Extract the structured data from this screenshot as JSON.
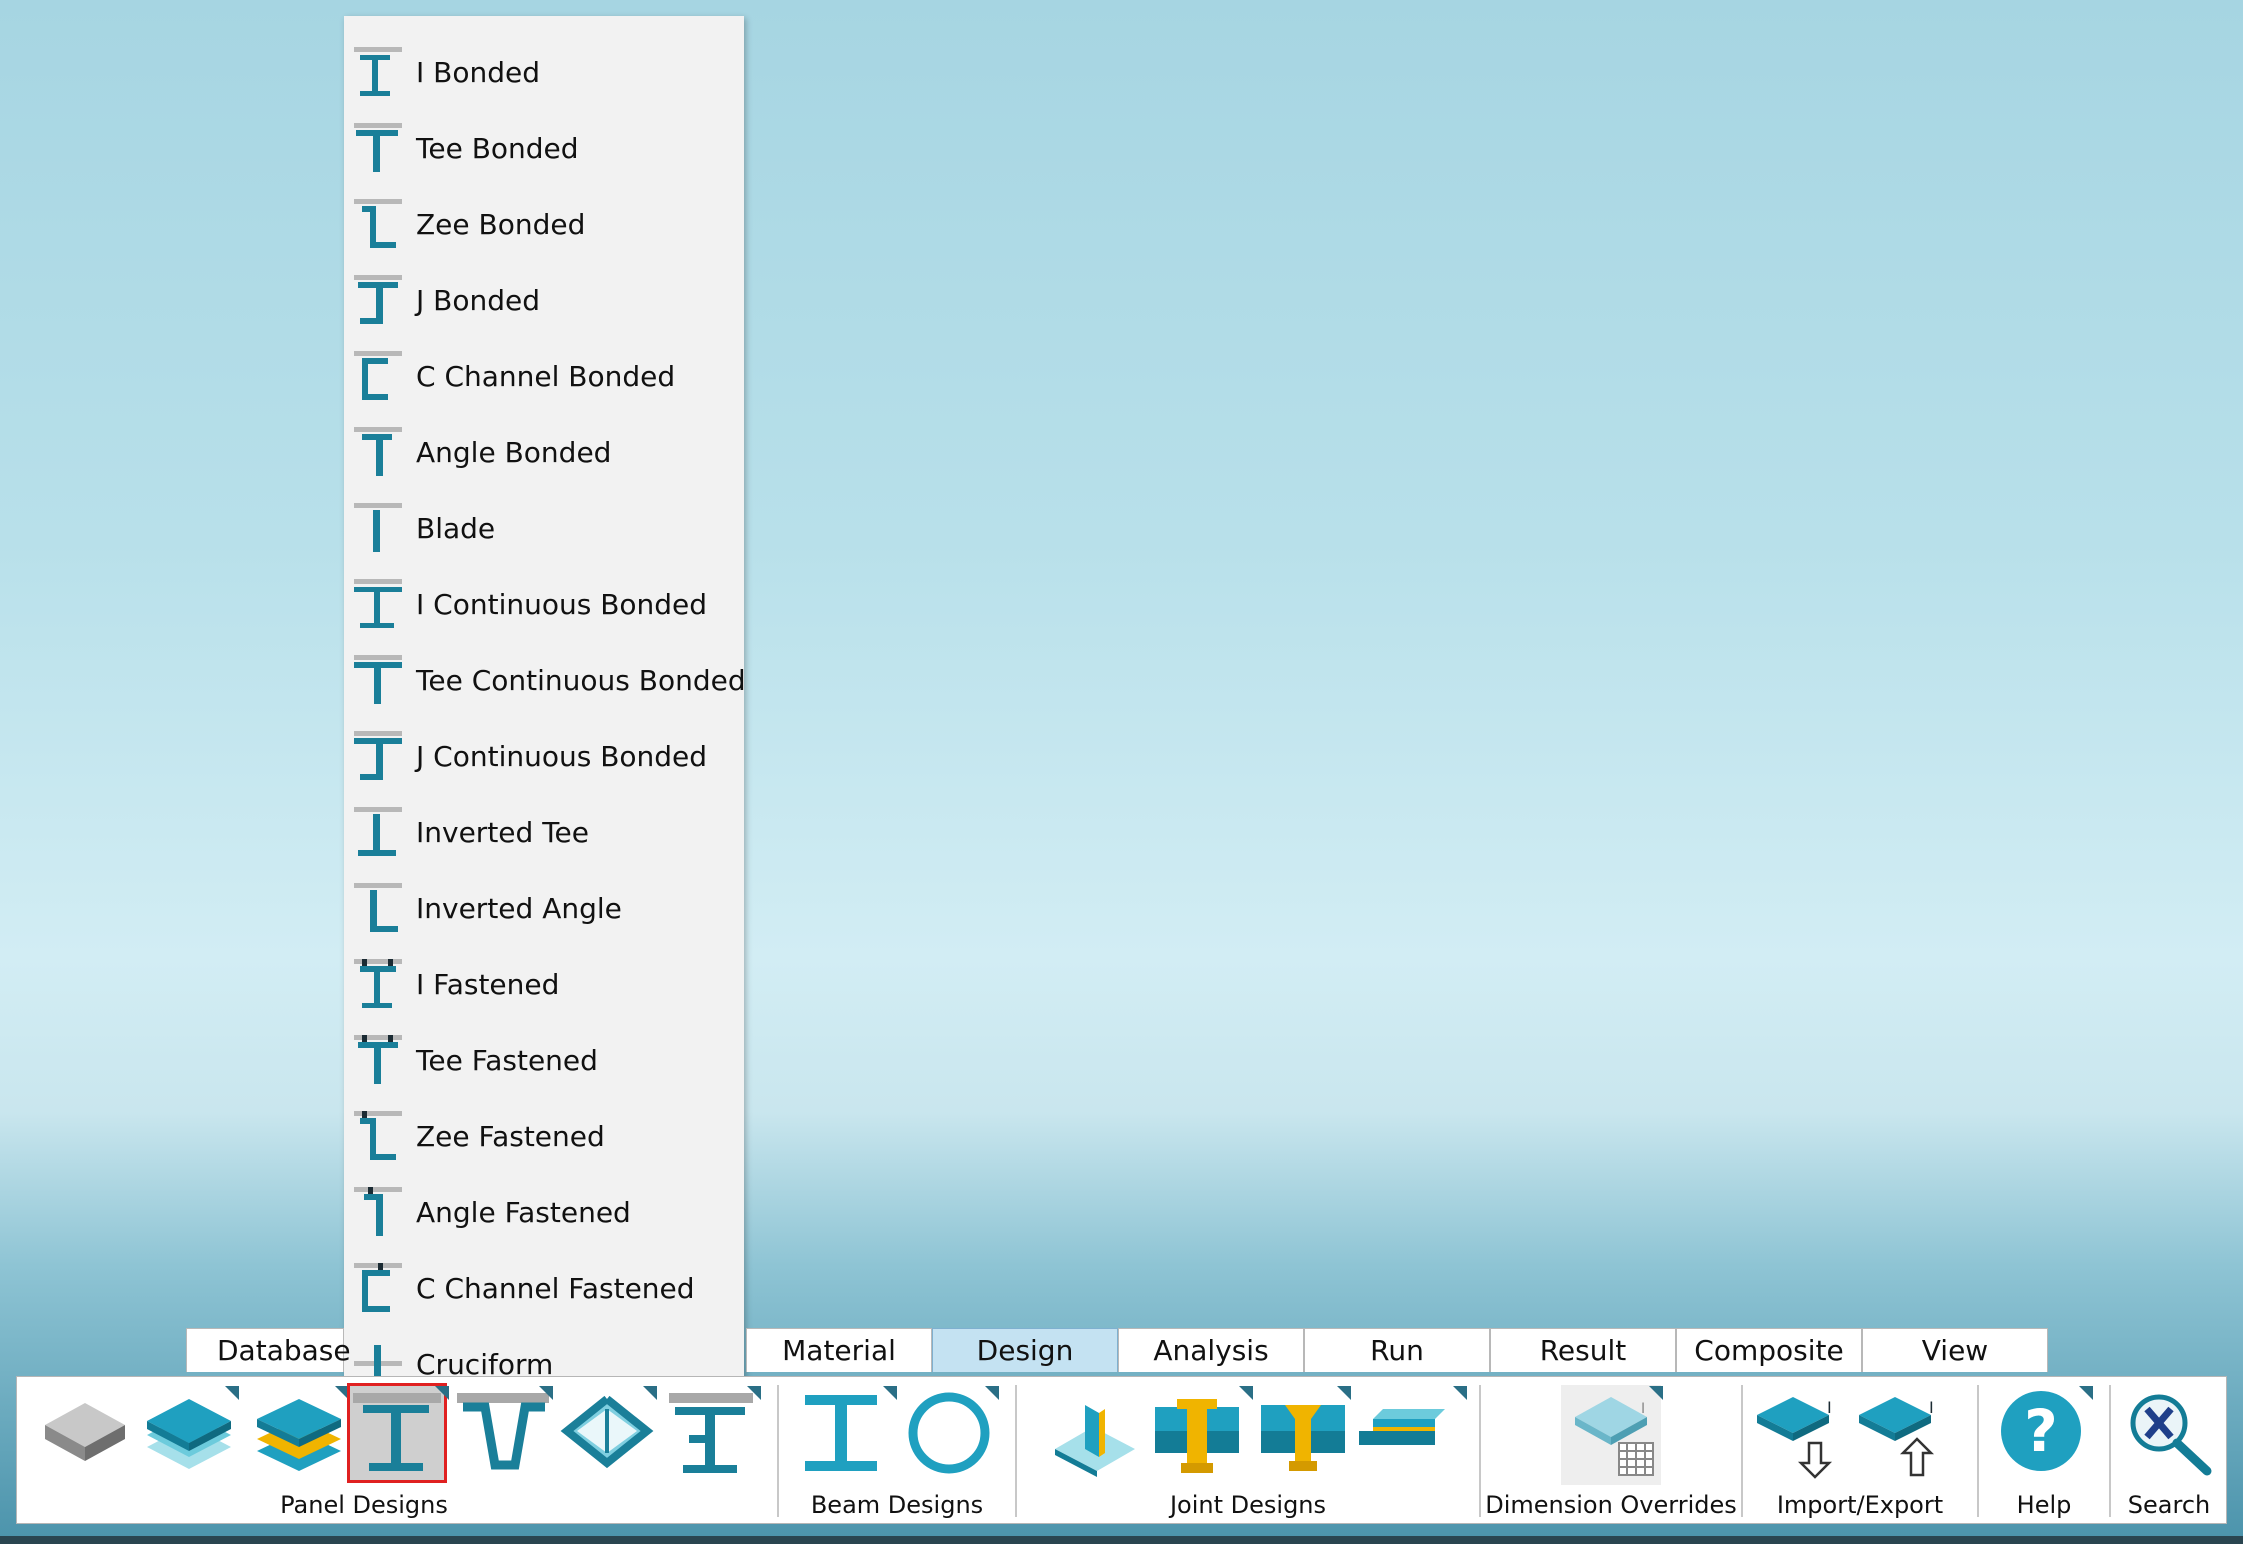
{
  "menu": {
    "items": [
      {
        "label": "I Bonded",
        "icon": "i-bonded-icon"
      },
      {
        "label": "Tee Bonded",
        "icon": "tee-bonded-icon"
      },
      {
        "label": "Zee Bonded",
        "icon": "zee-bonded-icon"
      },
      {
        "label": "J Bonded",
        "icon": "j-bonded-icon"
      },
      {
        "label": "C Channel Bonded",
        "icon": "c-channel-bonded-icon"
      },
      {
        "label": "Angle Bonded",
        "icon": "angle-bonded-icon"
      },
      {
        "label": "Blade",
        "icon": "blade-icon"
      },
      {
        "label": "I Continuous Bonded",
        "icon": "i-continuous-bonded-icon"
      },
      {
        "label": "Tee Continuous Bonded",
        "icon": "tee-continuous-bonded-icon"
      },
      {
        "label": "J Continuous Bonded",
        "icon": "j-continuous-bonded-icon"
      },
      {
        "label": "Inverted Tee",
        "icon": "inverted-tee-icon"
      },
      {
        "label": "Inverted Angle",
        "icon": "inverted-angle-icon"
      },
      {
        "label": "I Fastened",
        "icon": "i-fastened-icon"
      },
      {
        "label": "Tee Fastened",
        "icon": "tee-fastened-icon"
      },
      {
        "label": "Zee Fastened",
        "icon": "zee-fastened-icon"
      },
      {
        "label": "Angle Fastened",
        "icon": "angle-fastened-icon"
      },
      {
        "label": "C Channel Fastened",
        "icon": "c-channel-fastened-icon"
      },
      {
        "label": "Cruciform",
        "icon": "cruciform-icon"
      }
    ]
  },
  "tabs": [
    "Database",
    "Design",
    "Material",
    "Design",
    "Analysis",
    "Run",
    "Result",
    "Composite",
    "View"
  ],
  "tab_labels": {
    "database": "Database",
    "material": "Material",
    "design": "Design",
    "analysis": "Analysis",
    "run": "Run",
    "result": "Result",
    "composite": "Composite",
    "view": "View"
  },
  "active_tab": "Design",
  "ribbon": {
    "groups": {
      "panel": "Panel Designs",
      "beam": "Beam Designs",
      "joint": "Joint Designs",
      "dim": "Dimension Overrides",
      "io": "Import/Export",
      "help": "Help",
      "search": "Search"
    }
  },
  "colors": {
    "accent": "#1a7f99",
    "teal": "#1fa0c0",
    "gold": "#f0b400",
    "selection_outline": "#e02020"
  }
}
